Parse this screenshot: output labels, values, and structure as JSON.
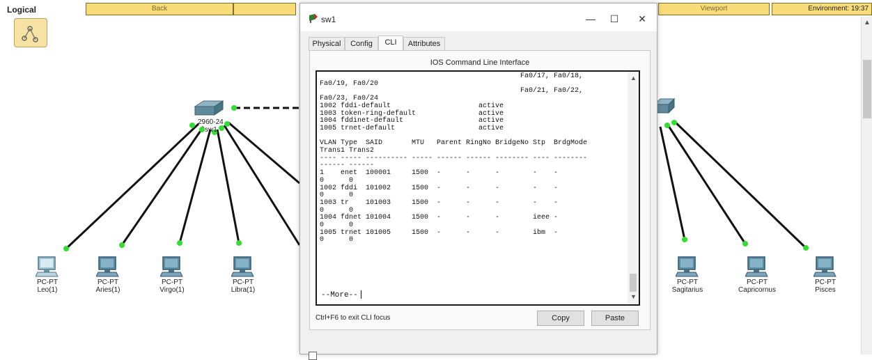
{
  "topbar": {
    "mode_label": "Logical",
    "back_label": "Back",
    "viewport_label": "Viewport",
    "environment_label": "Environment: 19:37"
  },
  "workspace": {
    "left_devices": [
      {
        "type": "PC-PT",
        "name": "Leo(1)"
      },
      {
        "type": "PC-PT",
        "name": "Aries(1)"
      },
      {
        "type": "PC-PT",
        "name": "Virgo(1)"
      },
      {
        "type": "PC-PT",
        "name": "Libra(1)"
      }
    ],
    "right_devices": [
      {
        "type": "PC-PT",
        "name": "Sagitarius"
      },
      {
        "type": "PC-PT",
        "name": "Capricornus"
      },
      {
        "type": "PC-PT",
        "name": "Pisces"
      }
    ],
    "switch_left": {
      "model": "2960-24",
      "name": "sw1"
    },
    "link_color": "#111111",
    "port_up_color": "#33dd33"
  },
  "dialog": {
    "title": "sw1",
    "tabs": [
      "Physical",
      "Config",
      "CLI",
      "Attributes"
    ],
    "active_tab": "CLI",
    "panel_title": "IOS Command Line Interface",
    "cli_lines": [
      "                                                Fa0/17, Fa0/18,",
      "Fa0/19, Fa0/20",
      "                                                Fa0/21, Fa0/22,",
      "Fa0/23, Fa0/24",
      "1002 fddi-default                     active",
      "1003 token-ring-default               active",
      "1004 fddinet-default                  active",
      "1005 trnet-default                    active",
      "",
      "VLAN Type  SAID       MTU   Parent RingNo BridgeNo Stp  BrdgMode",
      "Trans1 Trans2",
      "---- ----- ---------- ----- ------ ------ -------- ---- --------",
      "------ ------",
      "1    enet  100001     1500  -      -      -        -    -",
      "0      0",
      "1002 fddi  101002     1500  -      -      -        -    -",
      "0      0",
      "1003 tr    101003     1500  -      -      -        -    -",
      "0      0",
      "1004 fdnet 101004     1500  -      -      -        ieee -",
      "0      0",
      "1005 trnet 101005     1500  -      -      -        ibm  -",
      "0      0"
    ],
    "more_prompt": "--More--",
    "hint": "Ctrl+F6 to exit CLI focus",
    "copy_label": "Copy",
    "paste_label": "Paste",
    "window_buttons": {
      "minimize": "—",
      "maximize": "☐",
      "close": "✕"
    }
  }
}
